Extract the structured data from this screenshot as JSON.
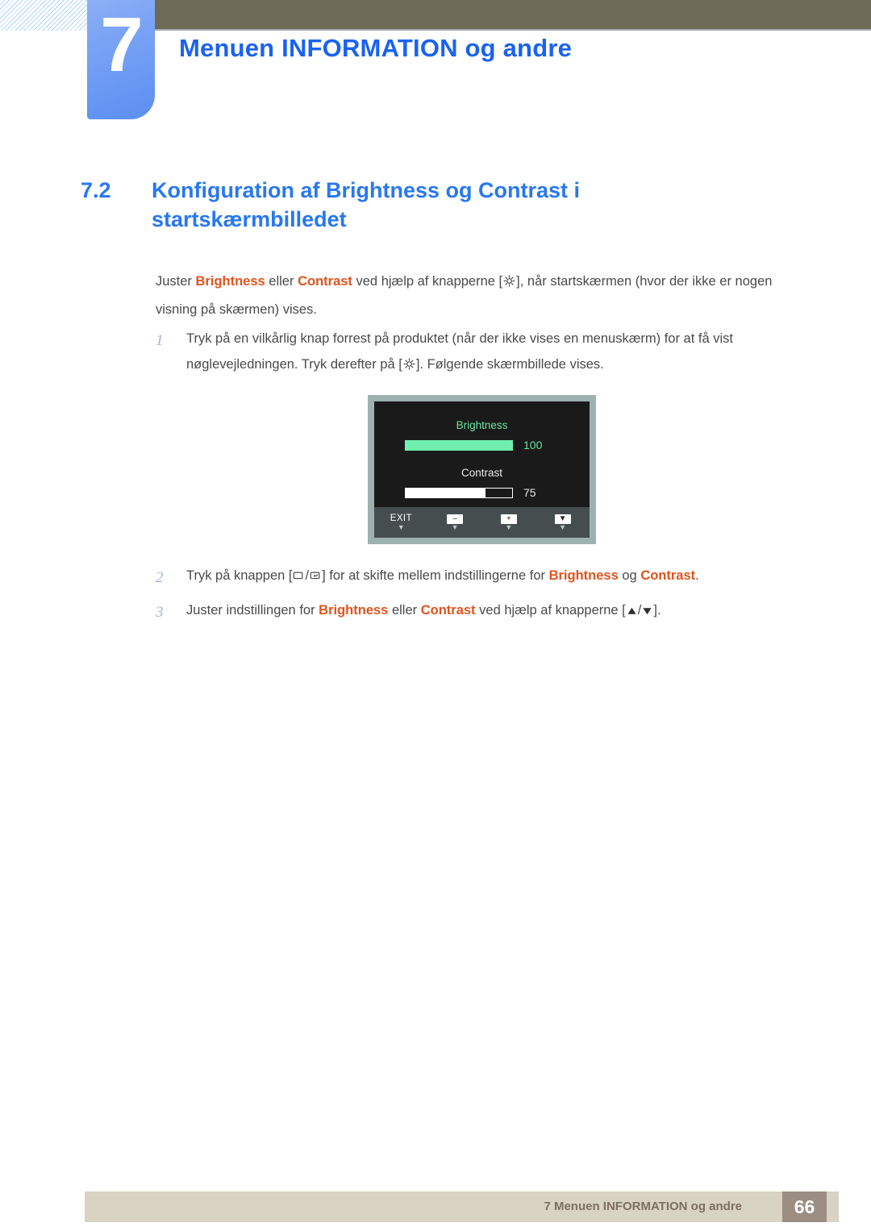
{
  "header": {
    "chapter_number": "7",
    "chapter_title": "Menuen INFORMATION og andre",
    "hatch_icon": "diagonal-hatch-decoration"
  },
  "section": {
    "number": "7.2",
    "title": "Konfiguration af Brightness og Contrast i startskærmbilledet"
  },
  "intro": {
    "part1": "Juster ",
    "kw1": "Brightness",
    "part2": " eller ",
    "kw2": "Contrast",
    "part3": " ved hjælp af knapperne [",
    "part4": "], når startskærmen (hvor der ikke er nogen visning på skærmen) vises."
  },
  "steps": [
    {
      "number": "1",
      "text_before": "Tryk på en vilkårlig knap forrest på produktet (når der ikke vises en menuskærm) for at få vist nøglevejledningen. Tryk derefter på [",
      "text_after": "]. Følgende skærmbillede vises."
    }
  ],
  "steps_lower": [
    {
      "number": "2",
      "t1": "Tryk på knappen [",
      "t2": "/",
      "t3": "] for at skifte mellem indstillingerne for ",
      "kw1": "Brightness",
      "t4": " og ",
      "kw2": "Contrast",
      "t5": "."
    },
    {
      "number": "3",
      "t1": "Juster indstillingen for ",
      "kw1": "Brightness",
      "t2": " eller ",
      "kw2": "Contrast",
      "t3": " ved hjælp af knapperne [",
      "t4": "/",
      "t5": "]."
    }
  ],
  "osd": {
    "brightness_label": "Brightness",
    "brightness_value": "100",
    "brightness_percent": 100,
    "contrast_label": "Contrast",
    "contrast_value": "75",
    "contrast_percent": 75,
    "buttons": [
      {
        "label": "EXIT",
        "icon": "exit-label",
        "caret": "▼"
      },
      {
        "label": "–",
        "icon": "minus-key-icon",
        "caret": "▼"
      },
      {
        "label": "+",
        "icon": "plus-key-icon",
        "caret": "▼"
      },
      {
        "label": "▼",
        "icon": "down-arrow-key-icon",
        "caret": "▼"
      }
    ],
    "colors": {
      "frame": "#9db2b0",
      "screen": "#1b1a1a",
      "brightness_green": "#6ff0b0",
      "footer_bar": "#454d4e"
    }
  },
  "footer": {
    "text": "7 Menuen INFORMATION og andre",
    "page_number": "66"
  },
  "colors": {
    "heading_blue": "#2878f0",
    "keyword_orange": "#e2531c",
    "olive_bar": "#6d6b57",
    "tab_blue": "#5b8ef2",
    "footer_beige": "#d8d3c2",
    "footer_page_box": "#9b8d82"
  }
}
